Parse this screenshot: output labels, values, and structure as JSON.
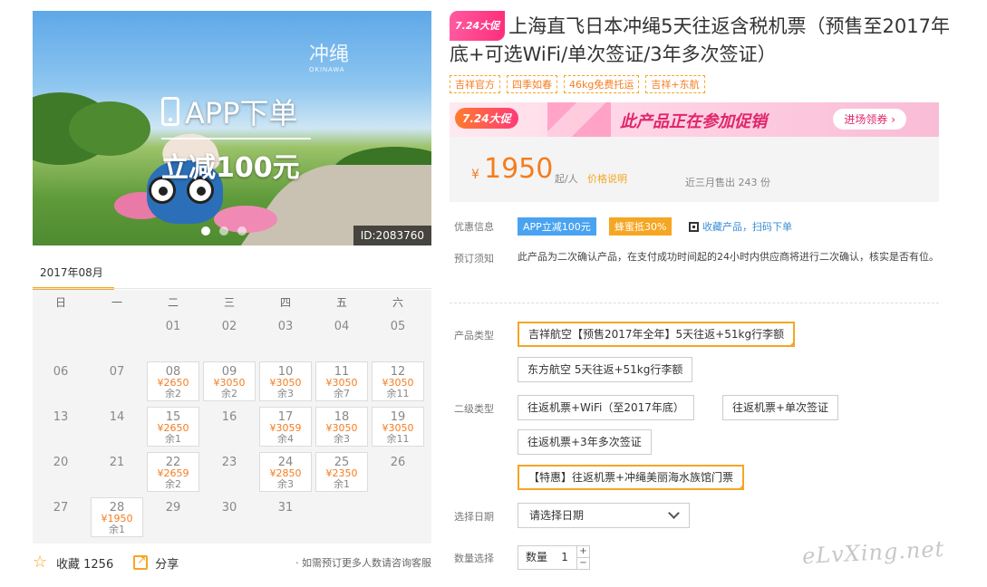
{
  "hero": {
    "promo_line1": "APP下单",
    "promo_line2": "立减100元",
    "brand": "冲绳",
    "brand_sub": "OKINAWA",
    "product_id": "ID:2083760"
  },
  "calendar": {
    "month": "2017年08月",
    "weekdays": [
      "日",
      "一",
      "二",
      "三",
      "四",
      "五",
      "六"
    ],
    "days": [
      {
        "d": ""
      },
      {
        "d": ""
      },
      {
        "d": "01"
      },
      {
        "d": "02"
      },
      {
        "d": "03"
      },
      {
        "d": "04"
      },
      {
        "d": "05"
      },
      {
        "d": "06"
      },
      {
        "d": "07"
      },
      {
        "d": "08",
        "price": "¥2650",
        "left": "余2"
      },
      {
        "d": "09",
        "price": "¥3050",
        "left": "余2"
      },
      {
        "d": "10",
        "price": "¥3050",
        "left": "余3"
      },
      {
        "d": "11",
        "price": "¥3050",
        "left": "余7"
      },
      {
        "d": "12",
        "price": "¥3050",
        "left": "余11"
      },
      {
        "d": "13"
      },
      {
        "d": "14"
      },
      {
        "d": "15",
        "price": "¥2650",
        "left": "余1"
      },
      {
        "d": "16"
      },
      {
        "d": "17",
        "price": "¥3059",
        "left": "余4"
      },
      {
        "d": "18",
        "price": "¥3050",
        "left": "余3"
      },
      {
        "d": "19",
        "price": "¥3050",
        "left": "余11"
      },
      {
        "d": "20"
      },
      {
        "d": "21"
      },
      {
        "d": "22",
        "price": "¥2659",
        "left": "余2"
      },
      {
        "d": "23"
      },
      {
        "d": "24",
        "price": "¥2850",
        "left": "余3"
      },
      {
        "d": "25",
        "price": "¥2350",
        "left": "余1"
      },
      {
        "d": "26"
      },
      {
        "d": "27"
      },
      {
        "d": "28",
        "price": "¥1950",
        "left": "余1"
      },
      {
        "d": "29"
      },
      {
        "d": "30"
      },
      {
        "d": "31"
      }
    ]
  },
  "actions": {
    "favorite_label": "收藏 1256",
    "share_label": "分享",
    "tip": "如需预订更多人数请咨询客服"
  },
  "product": {
    "badge": "7.24大促",
    "title": "上海直飞日本冲绳5天往返含税机票（预售至2017年底+可选WiFi/单次签证/3年多次签证）",
    "tags": [
      "吉祥官方",
      "四季如春",
      "46kg免费托运",
      "吉祥+东航"
    ]
  },
  "banner": {
    "badge": "7.24大促",
    "text": "此产品正在参加促销",
    "button": "进场领券 ›"
  },
  "price": {
    "currency": "¥",
    "amount": "1950",
    "unit": "起/人",
    "explain": "价格说明",
    "sold": "近三月售出 243 份"
  },
  "offers": {
    "label": "优惠信息",
    "app_coupon": "APP立减100元",
    "honey_coupon": "蜂蜜抵30%",
    "qr_link": "收藏产品，扫码下单"
  },
  "booking_notice": {
    "label": "预订须知",
    "text": "此产品为二次确认产品，在支付成功时间起的24小时内供应商将进行二次确认，核实是否有位。"
  },
  "product_type": {
    "label": "产品类型",
    "options": [
      "吉祥航空【预售2017年全年】5天往返+51kg行李额",
      "东方航空 5天往返+51kg行李额"
    ],
    "selected": 0
  },
  "sub_type": {
    "label": "二级类型",
    "options": [
      "往返机票+WiFi（至2017年底）",
      "往返机票+单次签证",
      "往返机票+3年多次签证",
      "【特惠】往返机票+冲绳美丽海水族馆门票"
    ],
    "selected": 3
  },
  "date": {
    "label": "选择日期",
    "placeholder": "请选择日期"
  },
  "quantity": {
    "label": "数量选择",
    "field_label": "数量",
    "value": "1",
    "plus": "+",
    "minus": "−"
  },
  "watermark": "eLvXing.net",
  "colors": {
    "accent": "#f5a623",
    "price": "#f47d20",
    "promo_pink": "#e0266a",
    "link_blue": "#3a8ed8"
  }
}
